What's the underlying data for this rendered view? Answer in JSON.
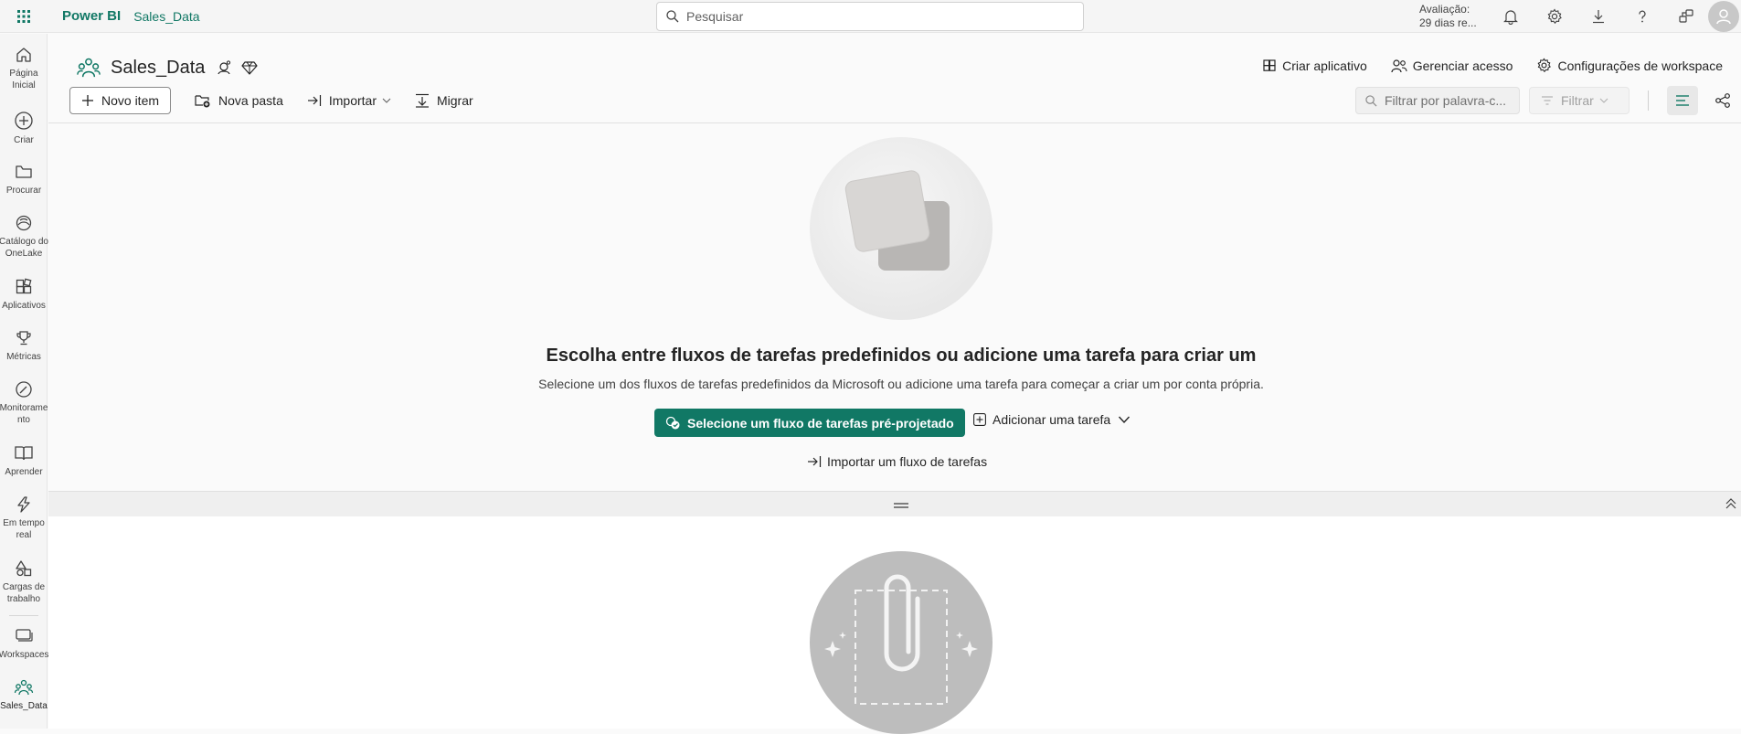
{
  "topbar": {
    "brand": "Power BI",
    "workspace": "Sales_Data",
    "search_placeholder": "Pesquisar",
    "trial_line1": "Avaliação:",
    "trial_line2": "29 dias re..."
  },
  "nav": {
    "items": [
      {
        "label": "Página Inicial",
        "icon": "home-icon"
      },
      {
        "label": "Criar",
        "icon": "plus-circle-icon"
      },
      {
        "label": "Procurar",
        "icon": "folder-icon"
      },
      {
        "label": "Catálogo do OneLake",
        "icon": "onelake-icon"
      },
      {
        "label": "Aplicativos",
        "icon": "apps-icon"
      },
      {
        "label": "Métricas",
        "icon": "trophy-icon"
      },
      {
        "label": "Monitoramento",
        "icon": "monitor-icon"
      },
      {
        "label": "Aprender",
        "icon": "book-icon"
      },
      {
        "label": "Em tempo real",
        "icon": "lightning-icon"
      },
      {
        "label": "Cargas de trabalho",
        "icon": "shapes-icon"
      },
      {
        "label": "Workspaces",
        "icon": "workspaces-icon"
      },
      {
        "label": "Sales_Data",
        "icon": "workspace-people-icon"
      }
    ],
    "monitor_line1": "Monitorame",
    "monitor_line2": "nto"
  },
  "header": {
    "title": "Sales_Data",
    "create_app": "Criar aplicativo",
    "manage_access": "Gerenciar acesso",
    "workspace_settings": "Configurações de workspace"
  },
  "toolbar": {
    "new_item": "Novo item",
    "new_folder": "Nova pasta",
    "import": "Importar",
    "migrate": "Migrar",
    "filter_placeholder": "Filtrar por palavra-c...",
    "filter": "Filtrar"
  },
  "empty_state": {
    "title": "Escolha entre fluxos de tarefas predefinidos ou adicione uma tarefa para criar um",
    "subtitle": "Selecione um dos fluxos de tarefas predefinidos da Microsoft ou adicione uma tarefa para começar a criar um por conta própria.",
    "primary_button": "Selecione um fluxo de tarefas pré-projetado",
    "add_task": "Adicionar uma tarefa",
    "import_flow": "Importar um fluxo de tarefas"
  },
  "colors": {
    "brand": "#117865",
    "nav_bg": "#f5f5f5"
  }
}
